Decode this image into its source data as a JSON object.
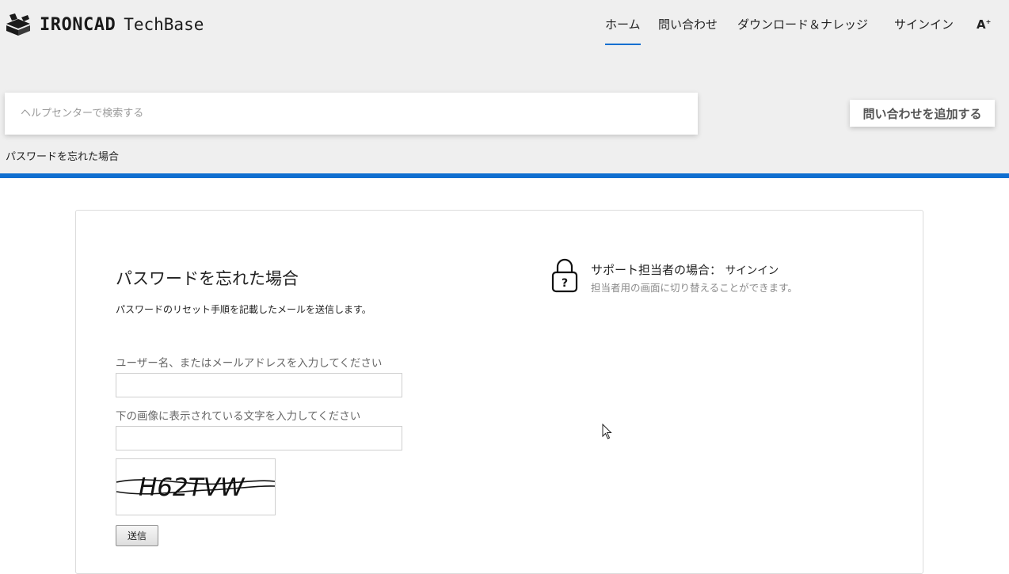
{
  "header": {
    "logo": {
      "brand": "IRONCAD",
      "product": "TechBase"
    },
    "nav": [
      {
        "label": "ホーム",
        "active": true
      },
      {
        "label": "問い合わせ",
        "active": false
      },
      {
        "label": "ダウンロード＆ナレッジ",
        "active": false
      },
      {
        "label": "サインイン",
        "active": false
      }
    ],
    "text_size_icon": "A",
    "search": {
      "placeholder": "ヘルプセンターで検索する",
      "value": ""
    },
    "add_request_label": "問い合わせを追加する",
    "breadcrumb": "パスワードを忘れた場合",
    "accent_color": "#0f6fd0"
  },
  "form": {
    "title": "パスワードを忘れた場合",
    "subtitle": "パスワードのリセット手順を記載したメールを送信します。",
    "username_label": "ユーザー名、またはメールアドレスを入力してください",
    "username_value": "",
    "captcha_label": "下の画像に表示されている文字を入力してください",
    "captcha_value": "",
    "captcha_text": "H62TVW",
    "submit_label": "送信"
  },
  "agent": {
    "title": "サポート担当者の場合：",
    "link": "サインイン",
    "description": "担当者用の画面に切り替えることができます。",
    "icon": "lock-question-icon"
  }
}
